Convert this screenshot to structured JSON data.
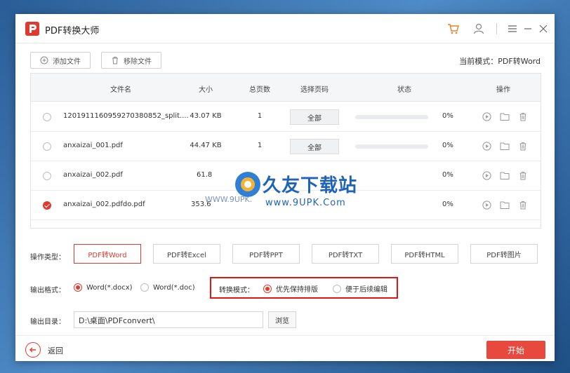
{
  "app": {
    "title": "PDF转换大师",
    "logo_letter": "P"
  },
  "toolbar": {
    "add_file": "添加文件",
    "remove_file": "移除文件",
    "mode_label": "当前模式：PDF转Word"
  },
  "table": {
    "headers": {
      "name": "文件名",
      "size": "大小",
      "pages": "总页数",
      "select_pages": "选择页码",
      "status": "状态",
      "actions": "操作"
    },
    "rows": [
      {
        "name": "1201911160959270380852_split....",
        "size": "43.07 KB",
        "pages": "1",
        "page_btn": "全部",
        "progress": "0%",
        "checked": false
      },
      {
        "name": "anxaizai_001.pdf",
        "size": "44.47 KB",
        "pages": "1",
        "page_btn": "全部",
        "progress": "0%",
        "checked": false
      },
      {
        "name": "anxaizai_002.pdf",
        "size": "61.8",
        "pages": "",
        "page_btn": "",
        "progress": "0%",
        "checked": false
      },
      {
        "name": "anxaizai_002.pdfdo.pdf",
        "size": "353.6",
        "pages": "",
        "page_btn": "",
        "progress": "0%",
        "checked": true
      }
    ]
  },
  "watermark": {
    "line1": "久友下载站",
    "line2": "www.9UPK.Com",
    "line3": "WWW.9UPK."
  },
  "ops": {
    "type_label": "操作类型：",
    "types": [
      "PDF转Word",
      "PDF转Excel",
      "PDF转PPT",
      "PDF转TXT",
      "PDF转HTML",
      "PDF转图片"
    ],
    "active_type": 0,
    "format_label": "输出格式：",
    "formats": [
      "Word(*.docx)",
      "Word(*.doc)"
    ],
    "convert_label": "转换模式：",
    "convert_modes": [
      "优先保持排版",
      "便于后续编辑"
    ],
    "dir_label": "输出目录：",
    "dir_value": "D:\\桌面\\PDFconvert\\",
    "browse": "浏览"
  },
  "footer": {
    "back": "返回",
    "start": "开始"
  },
  "colors": {
    "accent": "#e03a2f",
    "highlight": "#e01515"
  }
}
